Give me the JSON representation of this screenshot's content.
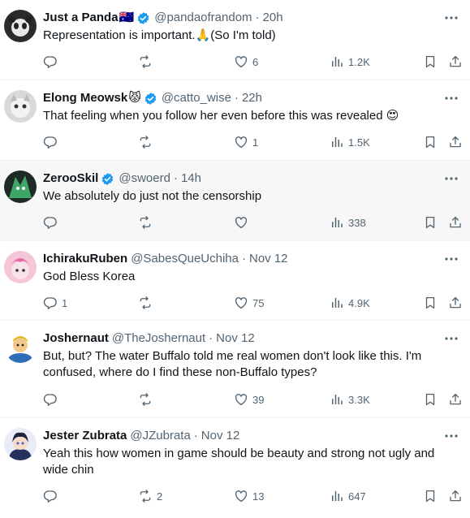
{
  "colors": {
    "text": "#0f1419",
    "secondary": "#536471",
    "verified": "#1d9bf0",
    "highlight_bg": "#f7f7f7",
    "divider": "#eff3f4"
  },
  "icons": {
    "reply": "reply-icon",
    "retweet": "retweet-icon",
    "like": "heart-icon",
    "views": "views-icon",
    "bookmark": "bookmark-icon",
    "share": "share-icon",
    "more": "more-icon",
    "verified": "verified-badge-icon"
  },
  "tweets": [
    {
      "name": "Just a Panda",
      "name_emoji": "🇦🇺",
      "handle": "@pandaofrandom",
      "time": "20h",
      "text": "Representation is important.🙏(So I'm told)",
      "replies": "",
      "retweets": "",
      "likes": "6",
      "views": "1.2K"
    },
    {
      "name": "Elong Meowsk",
      "name_emoji": "😾",
      "handle": "@catto_wise",
      "time": "22h",
      "text": "That  feeling when you follow her even before this was revealed 😍",
      "replies": "",
      "retweets": "",
      "likes": "1",
      "views": "1.5K"
    },
    {
      "name": "ZerooSkil",
      "name_emoji": "",
      "handle": "@swoerd",
      "time": "14h",
      "text": "We absolutely do just not the censorship",
      "replies": "",
      "retweets": "",
      "likes": "",
      "views": "338"
    },
    {
      "name": "IchirakuRuben",
      "name_emoji": "",
      "handle": "@SabesQueUchiha",
      "time": "Nov 12",
      "text": "God Bless Korea",
      "replies": "1",
      "retweets": "",
      "likes": "75",
      "views": "4.9K"
    },
    {
      "name": "Joshernaut",
      "name_emoji": "",
      "handle": "@TheJoshernaut",
      "time": "Nov 12",
      "text": "But, but? The water Buffalo told me real women don't look like this. I'm confused, where do I find these non-Buffalo types?",
      "replies": "",
      "retweets": "",
      "likes": "39",
      "views": "3.3K"
    },
    {
      "name": "Jester Zubrata",
      "name_emoji": "",
      "handle": "@JZubrata",
      "time": "Nov 12",
      "text": "Yeah this how women in game  should be beauty and strong not ugly and wide chin",
      "replies": "",
      "retweets": "2",
      "likes": "13",
      "views": "647"
    }
  ]
}
